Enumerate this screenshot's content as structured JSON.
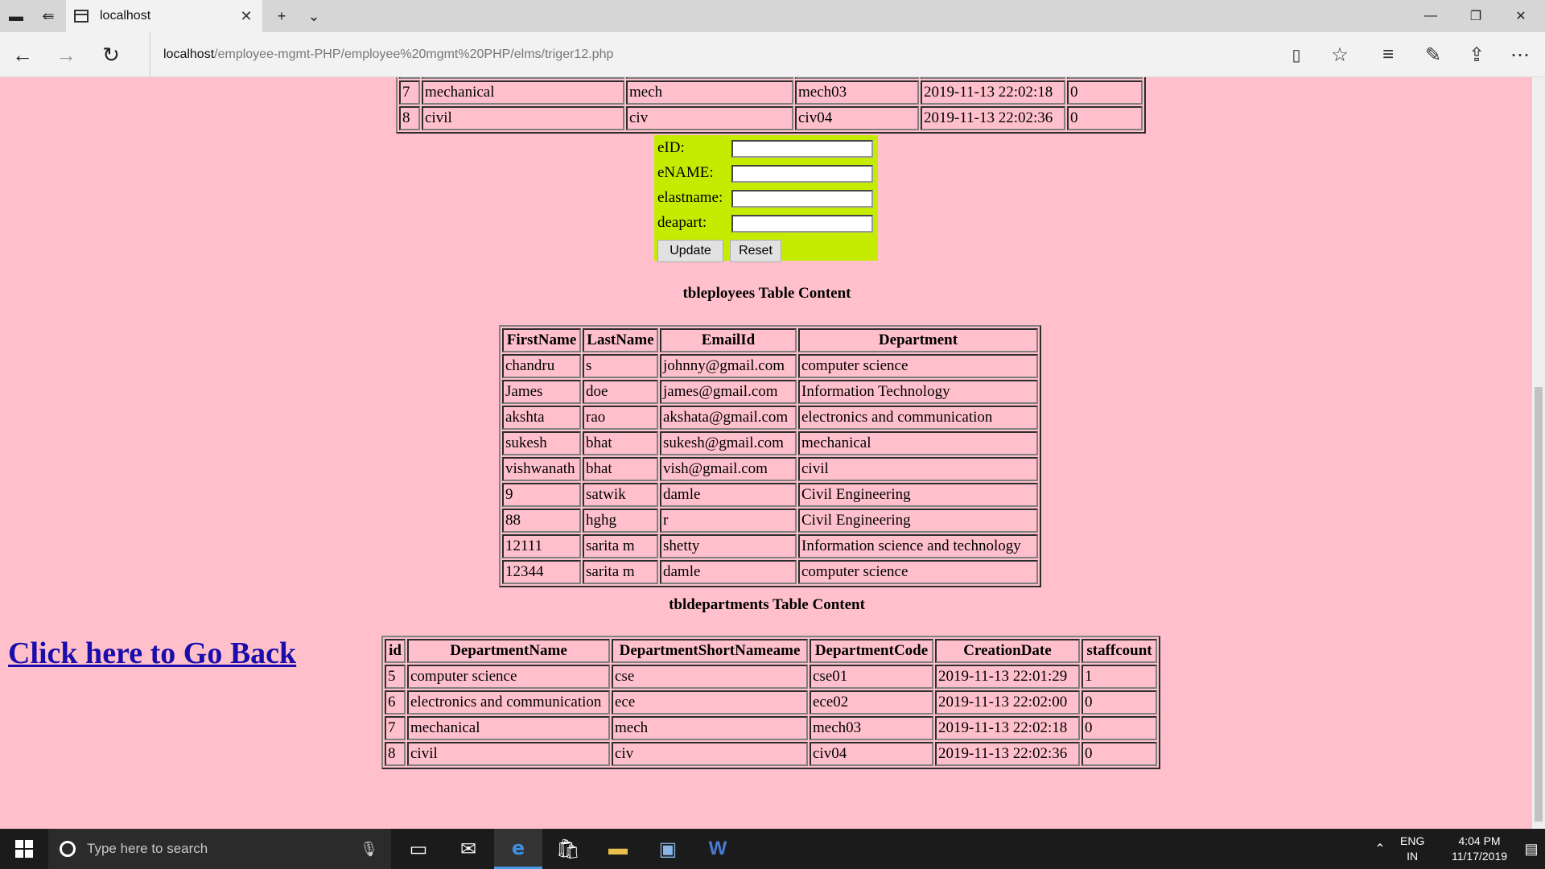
{
  "browser": {
    "tab_title": "localhost",
    "url_host": "localhost",
    "url_path": "/employee-mgmt-PHP/employee%20mgmt%20PHP/elms/triger12.php"
  },
  "top_table": {
    "rows": [
      [
        "7",
        "mechanical",
        "mech",
        "mech03",
        "2019-11-13 22:02:18",
        "0"
      ],
      [
        "8",
        "civil",
        "civ",
        "civ04",
        "2019-11-13 22:02:36",
        "0"
      ]
    ]
  },
  "form": {
    "eid_label": "eID:",
    "ename_label": "eNAME:",
    "elastname_label": "elastname:",
    "deapart_label": "deapart:",
    "update_label": "Update",
    "reset_label": "Reset",
    "bg_color": "#c5ec00"
  },
  "employees": {
    "title": "tbleployees Table Content",
    "headers": [
      "FirstName",
      "LastName",
      "EmailId",
      "Department"
    ],
    "rows": [
      [
        "chandru",
        "s",
        "johnny@gmail.com",
        "computer science"
      ],
      [
        "James",
        "doe",
        "james@gmail.com",
        "Information Technology"
      ],
      [
        "akshta",
        "rao",
        "akshata@gmail.com",
        "electronics and communication"
      ],
      [
        "sukesh",
        "bhat",
        "sukesh@gmail.com",
        "mechanical"
      ],
      [
        "vishwanath",
        "bhat",
        "vish@gmail.com",
        "civil"
      ],
      [
        "9",
        "satwik",
        "damle",
        "Civil Engineering"
      ],
      [
        "88",
        "hghg",
        "r",
        "Civil Engineering"
      ],
      [
        "12111",
        "sarita m",
        "shetty",
        "Information science and technology"
      ],
      [
        "12344",
        "sarita m",
        "damle",
        "computer science"
      ]
    ]
  },
  "departments": {
    "title": "tbldepartments Table Content",
    "headers": [
      "id",
      "DepartmentName",
      "DepartmentShortNameame",
      "DepartmentCode",
      "CreationDate",
      "staffcount"
    ],
    "rows": [
      [
        "5",
        "computer science",
        "cse",
        "cse01",
        "2019-11-13 22:01:29",
        "1"
      ],
      [
        "6",
        "electronics and communication",
        "ece",
        "ece02",
        "2019-11-13 22:02:00",
        "0"
      ],
      [
        "7",
        "mechanical",
        "mech",
        "mech03",
        "2019-11-13 22:02:18",
        "0"
      ],
      [
        "8",
        "civil",
        "civ",
        "civ04",
        "2019-11-13 22:02:36",
        "0"
      ]
    ]
  },
  "go_back_label": "Click here to Go Back",
  "page_bg_color": "#ffc0cb",
  "link_color": "#1a0dab",
  "taskbar": {
    "search_placeholder": "Type here to search",
    "lang_line1": "ENG",
    "lang_line2": "IN",
    "time": "4:04 PM",
    "date": "11/17/2019"
  }
}
